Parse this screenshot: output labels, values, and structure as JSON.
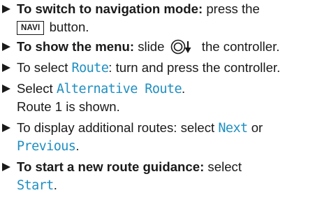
{
  "steps": [
    {
      "bold": "To switch to navigation mode:",
      "line1": " press the",
      "key": "NAVI",
      "after_key": " button."
    },
    {
      "bold": "To show the menu:",
      "pre_icon": " slide ",
      "icon": "controller-slide-down-icon",
      "post_icon": " the controller."
    },
    {
      "pre": "To select ",
      "hl": "Route",
      "post": ": turn and press the controller."
    },
    {
      "pre": "Select ",
      "hl": "Alternative Route",
      "post": ".",
      "line2": "Route 1 is shown."
    },
    {
      "pre": "To display additional routes: select ",
      "hl1": "Next",
      "mid": " or",
      "hl2": "Previous",
      "post": "."
    },
    {
      "bold": "To start a new route guidance:",
      "pre": " select",
      "hl": "Start",
      "post": "."
    }
  ],
  "colors": {
    "text": "#1a1a1a",
    "highlight": "#1f8fc2"
  }
}
